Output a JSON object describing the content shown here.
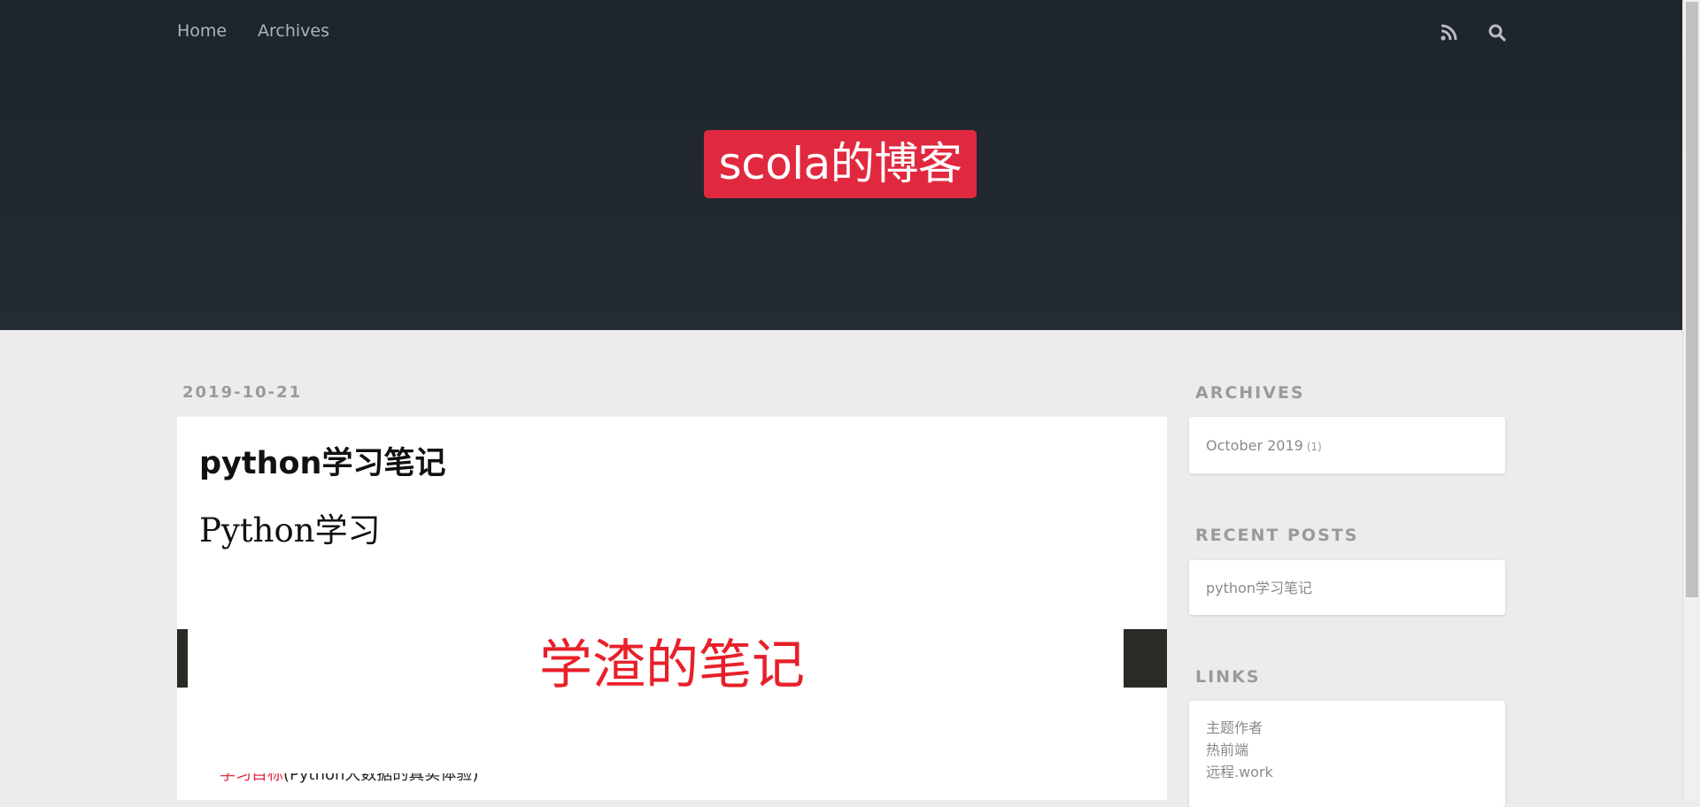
{
  "nav": {
    "home_label": "Home",
    "archives_label": "Archives"
  },
  "header": {
    "site_title": "scola的博客",
    "title_bg_color": "#e0293f",
    "icons": [
      "rss-icon",
      "search-icon"
    ]
  },
  "post": {
    "date": "2019-10-21",
    "title": "python学习笔记",
    "heading": "Python学习",
    "banner_text": "学渣的笔记",
    "banner_color": "#e8202a",
    "cut_line_red": "学习目标",
    "cut_line_rest": "(Python大数据的真实体验)"
  },
  "sidebar": {
    "archives": {
      "heading": "ARCHIVES",
      "items": [
        {
          "label": "October 2019",
          "count": "(1)"
        }
      ]
    },
    "recent_posts": {
      "heading": "RECENT POSTS",
      "items": [
        {
          "label": "python学习笔记"
        }
      ]
    },
    "links": {
      "heading": "LINKS",
      "items": [
        {
          "label": "主题作者"
        },
        {
          "label": "热前端"
        },
        {
          "label": "远程.work"
        }
      ]
    }
  }
}
